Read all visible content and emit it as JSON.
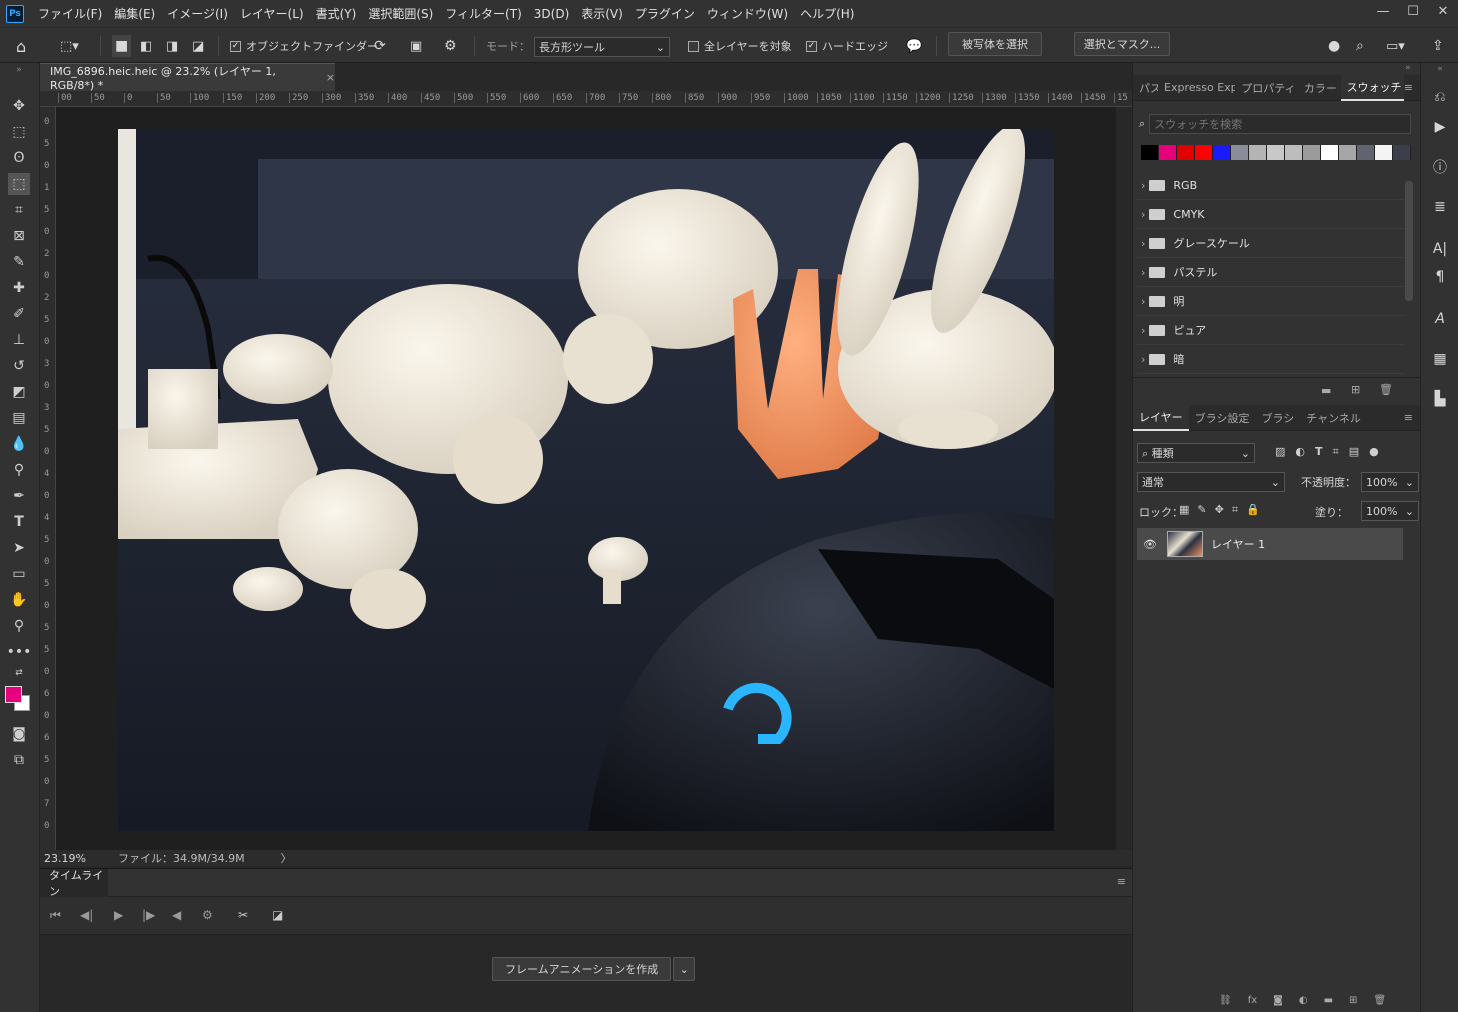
{
  "app": {
    "logo": "Ps",
    "accent": "#31a8ff"
  },
  "menu": [
    "ファイル(F)",
    "編集(E)",
    "イメージ(I)",
    "レイヤー(L)",
    "書式(Y)",
    "選択範囲(S)",
    "フィルター(T)",
    "3D(D)",
    "表示(V)",
    "プラグイン",
    "ウィンドウ(W)",
    "ヘルプ(H)"
  ],
  "window_controls": {
    "minimize": "—",
    "maximize": "☐",
    "close": "✕"
  },
  "options": {
    "object_finder": "オブジェクトファインダー",
    "mode_label": "モード：",
    "mode_value": "長方形ツール",
    "all_layers": "全レイヤーを対象",
    "hard_edge": "ハードエッジ",
    "select_subject": "被写体を選択",
    "select_mask": "選択とマスク..."
  },
  "document": {
    "tab_title": "IMG_6896.heic.heic @ 23.2% (レイヤー 1, RGB/8*) *",
    "close": "×",
    "zoom": "23.19%",
    "file_info": "ファイル：34.9M/34.9M",
    "status_arrow": "〉"
  },
  "ruler": {
    "h": [
      "00",
      "50",
      "0",
      "50",
      "100",
      "150",
      "200",
      "250",
      "300",
      "350",
      "400",
      "450",
      "500",
      "550",
      "600",
      "650",
      "700",
      "750",
      "800",
      "850",
      "900",
      "950",
      "1000",
      "1050",
      "1100",
      "1150",
      "1200",
      "1250",
      "1300",
      "1350",
      "1400",
      "1450",
      "15"
    ],
    "v": [
      "0",
      "5",
      "0",
      "1",
      "5",
      "0",
      "2",
      "0",
      "2",
      "5",
      "0",
      "3",
      "0",
      "3",
      "5",
      "0",
      "4",
      "0",
      "4",
      "5",
      "0",
      "5",
      "0",
      "5",
      "5",
      "0",
      "6",
      "0",
      "6",
      "5",
      "0",
      "7",
      "0"
    ]
  },
  "timeline": {
    "tab": "タイムライン",
    "create_button": "フレームアニメーションを作成"
  },
  "swatches_panel": {
    "tabs": [
      "パス",
      "Expresso Expor",
      "プロパティ",
      "カラー",
      "スウォッチ"
    ],
    "search_placeholder": "スウォッチを検索",
    "colors": [
      "#000000",
      "#e8007a",
      "#e00000",
      "#ff0000",
      "#1a1aff",
      "#8a8d99",
      "#b4b4b4",
      "#c8c8c8",
      "#bdbdbd",
      "#9b9b9b",
      "#ffffff",
      "#a6a6a6",
      "#5f6470",
      "#f4f4f4",
      "#3b3f4a"
    ],
    "folders": [
      "RGB",
      "CMYK",
      "グレースケール",
      "パステル",
      "明",
      "ピュア",
      "暗"
    ]
  },
  "layers_panel": {
    "tabs": [
      "レイヤー",
      "ブラシ設定",
      "ブラシ",
      "チャンネル"
    ],
    "kind_filter": "種類",
    "blend_mode": "通常",
    "opacity_label": "不透明度：",
    "opacity_value": "100%",
    "lock_label": "ロック：",
    "fill_label": "塗り：",
    "fill_value": "100%",
    "layers": [
      {
        "name": "レイヤー 1",
        "visible": true
      }
    ]
  },
  "foreground_color": "#e6007e",
  "background_color": "#ffffff"
}
